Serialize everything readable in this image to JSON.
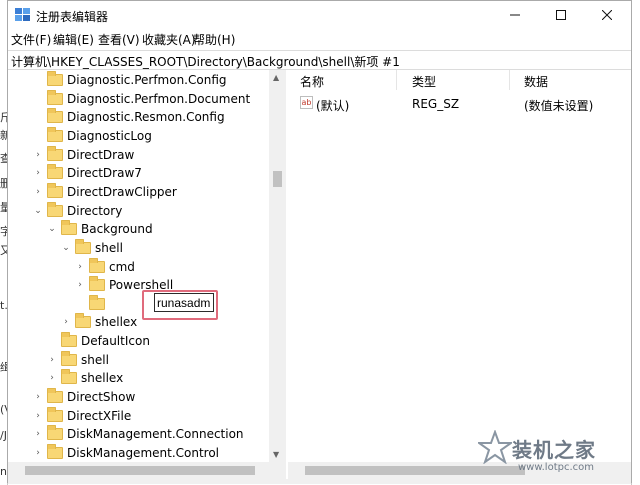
{
  "window": {
    "title": "注册表编辑器",
    "controls": [
      "minimize",
      "maximize",
      "close"
    ]
  },
  "menu": [
    {
      "label": "文件(F)"
    },
    {
      "label": "编辑(E)"
    },
    {
      "label": "查看(V)"
    },
    {
      "label": "收藏夹(A)"
    },
    {
      "label": "帮助(H)"
    }
  ],
  "address": "计算机\\HKEY_CLASSES_ROOT\\Directory\\Background\\shell\\新项 #1",
  "tree": [
    {
      "label": "Diagnostic.Perfmon.Config",
      "expander": "none"
    },
    {
      "label": "Diagnostic.Perfmon.Document",
      "expander": "none"
    },
    {
      "label": "Diagnostic.Resmon.Config",
      "expander": "none"
    },
    {
      "label": "DiagnosticLog",
      "expander": "none"
    },
    {
      "label": "DirectDraw",
      "expander": "collapsed"
    },
    {
      "label": "DirectDraw7",
      "expander": "collapsed"
    },
    {
      "label": "DirectDrawClipper",
      "expander": "collapsed"
    },
    {
      "label": "Directory",
      "expander": "expanded"
    },
    {
      "label": "Background",
      "expander": "expanded"
    },
    {
      "label": "shell",
      "expander": "expanded"
    },
    {
      "label": "cmd",
      "expander": "collapsed"
    },
    {
      "label": "Powershell",
      "expander": "collapsed"
    },
    {
      "label": "",
      "expander": "none"
    },
    {
      "label": "shellex",
      "expander": "collapsed"
    },
    {
      "label": "DefaultIcon",
      "expander": "none"
    },
    {
      "label": "shell",
      "expander": "collapsed"
    },
    {
      "label": "shellex",
      "expander": "collapsed"
    },
    {
      "label": "DirectShow",
      "expander": "collapsed"
    },
    {
      "label": "DirectXFile",
      "expander": "collapsed"
    },
    {
      "label": "DiskManagement.Connection",
      "expander": "collapsed"
    },
    {
      "label": "DiskManagement.Control",
      "expander": "collapsed"
    }
  ],
  "rename_value": "runasadmin",
  "values_table": {
    "headers": {
      "name": "名称",
      "type": "类型",
      "data": "数据"
    },
    "rows": [
      {
        "name": "(默认)",
        "type": "REG_SZ",
        "data": "(数值未设置)",
        "icon": "string-value-icon"
      }
    ]
  },
  "watermark": {
    "text": "装机之家",
    "url": "www.lotpc.com"
  },
  "background_fragments": {
    "left": [
      "斤",
      "新",
      "查",
      "删",
      "量",
      "字",
      "又",
      "t.",
      "缉",
      "(V",
      "/J",
      "n"
    ]
  },
  "colors": {
    "rename_highlight": "#e06b7c",
    "folder": "#f8d775",
    "selection_border": "#2b2b2b"
  }
}
